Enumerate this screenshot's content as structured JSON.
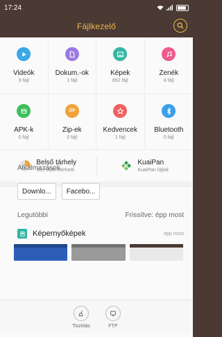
{
  "status": {
    "time": "17:24"
  },
  "app": {
    "title": "Fájlkezelő"
  },
  "categories": [
    {
      "label": "Videók",
      "sub": "9 fájl",
      "color": "#3aa7e6",
      "icon": "play-icon"
    },
    {
      "label": "Dokum.-ok",
      "sub": "1 fájl",
      "color": "#9b7ae3",
      "icon": "document-icon"
    },
    {
      "label": "Képek",
      "sub": "852 fájl",
      "color": "#36b6a2",
      "icon": "image-icon"
    },
    {
      "label": "Zenék",
      "sub": "8 fájl",
      "color": "#f05a8e",
      "icon": "music-icon"
    },
    {
      "label": "APK-k",
      "sub": "0 fájl",
      "color": "#3fbf5a",
      "icon": "apk-icon"
    },
    {
      "label": "Zip-ek",
      "sub": "0 fájl",
      "color": "#f0a33a",
      "icon": "zip-icon",
      "badge": "ZIP"
    },
    {
      "label": "Kedvencek",
      "sub": "1 fájl",
      "color": "#f0615e",
      "icon": "star-icon"
    },
    {
      "label": "Bluetooth",
      "sub": "0 fájl",
      "color": "#3aa0ea",
      "icon": "bluetooth-icon"
    }
  ],
  "storage": {
    "internal": {
      "title": "Belső tárhely",
      "sub": "18,79GB elérhető",
      "used_fraction": 0.28
    },
    "kuaipan": {
      "title": "KuaiPan",
      "sub": "KuaiPan fájlok"
    }
  },
  "apps": {
    "heading": "Alkalmazások",
    "items": [
      {
        "label": "Downlo..."
      },
      {
        "label": "Facebo..."
      }
    ]
  },
  "recent": {
    "heading": "Legutóbbi",
    "refresh": "Frissítve: épp most",
    "item": {
      "name": "Képernyőképek",
      "time": "épp most"
    }
  },
  "bottom": {
    "clean": {
      "label": "Tisztítás"
    },
    "ftp": {
      "label": "FTP"
    }
  }
}
